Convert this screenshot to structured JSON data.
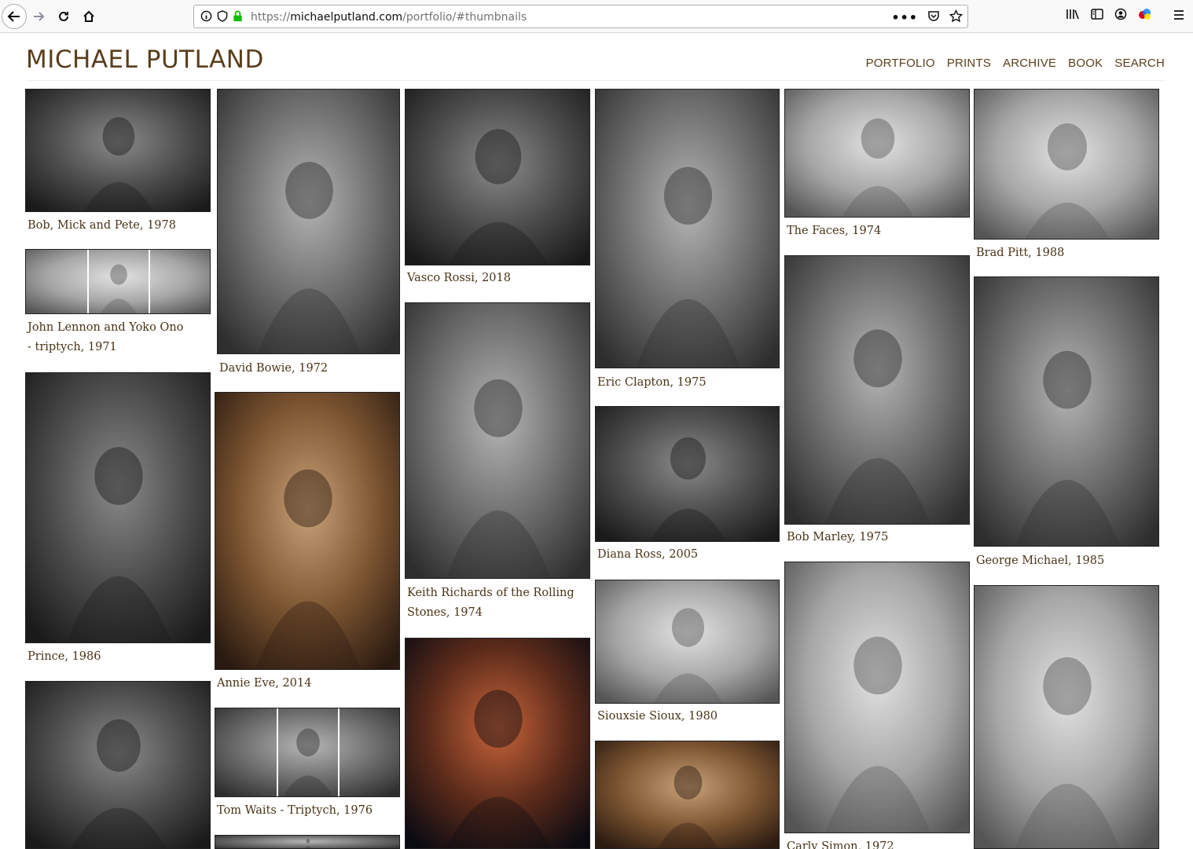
{
  "browser": {
    "url_prefix": "https://",
    "url_host": "michaelputland.com",
    "url_path": "/portfolio/#thumbnails",
    "icons": [
      "back-arrow-icon",
      "forward-arrow-icon",
      "reload-icon",
      "home-icon",
      "info-icon",
      "shield-icon",
      "lock-icon",
      "more-icon",
      "pocket-icon",
      "star-icon",
      "library-icon",
      "sidebar-icon",
      "account-icon",
      "extension-icon",
      "menu-icon"
    ]
  },
  "site": {
    "logo": "MICHAEL PUTLAND",
    "nav": [
      "PORTFOLIO",
      "PRINTS",
      "ARCHIVE",
      "BOOK",
      "SEARCH"
    ],
    "brand_color": "#5a3e1b"
  },
  "photos": [
    {
      "caption": "Bob, Mick and Pete, 1978"
    },
    {
      "caption": "John Lennon and Yoko Ono - triptych, 1971"
    },
    {
      "caption": "Prince, 1986"
    },
    {
      "caption": ""
    },
    {
      "caption": "David Bowie, 1972"
    },
    {
      "caption": "Annie Eve, 2014"
    },
    {
      "caption": "Tom Waits - Triptych, 1976"
    },
    {
      "caption": ""
    },
    {
      "caption": "Vasco Rossi, 2018"
    },
    {
      "caption": "Keith Richards of the Rolling Stones, 1974"
    },
    {
      "caption": ""
    },
    {
      "caption": "Eric Clapton, 1975"
    },
    {
      "caption": "Diana Ross, 2005"
    },
    {
      "caption": "Siouxsie Sioux, 1980"
    },
    {
      "caption": ""
    },
    {
      "caption": "The Faces, 1974"
    },
    {
      "caption": "Bob Marley, 1975"
    },
    {
      "caption": "Carly Simon, 1972"
    },
    {
      "caption": "Brad Pitt, 1988"
    },
    {
      "caption": "George Michael, 1985"
    },
    {
      "caption": ""
    }
  ]
}
